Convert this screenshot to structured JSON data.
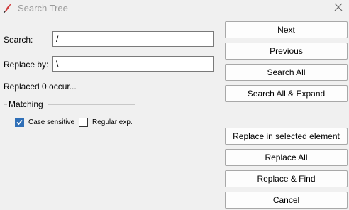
{
  "window": {
    "title": "Search Tree",
    "icon": "feather-pen-icon"
  },
  "form": {
    "search_label": "Search:",
    "search_value": "/",
    "replace_label": "Replace by:",
    "replace_value": "\\"
  },
  "status": "Replaced 0 occur...",
  "matching": {
    "group_label": "Matching",
    "case_sensitive": {
      "label": "Case sensitive",
      "checked": true
    },
    "regular_exp": {
      "label": "Regular exp.",
      "checked": false
    }
  },
  "buttons": {
    "next": "Next",
    "previous": "Previous",
    "search_all": "Search All",
    "search_all_expand": "Search All & Expand",
    "replace_selected": "Replace in selected element",
    "replace_all": "Replace All",
    "replace_find": "Replace & Find",
    "cancel": "Cancel"
  },
  "colors": {
    "accent": "#2f6fb7",
    "title_text": "#9a9a9a"
  }
}
